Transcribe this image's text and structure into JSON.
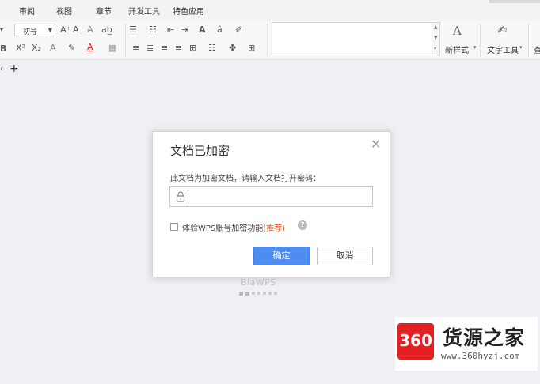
{
  "menubar": {
    "items": [
      "审阅",
      "视图",
      "章节",
      "开发工具",
      "特色应用"
    ]
  },
  "ribbon": {
    "font_size_value": "初号",
    "row1_icons": [
      "A⁺",
      "A⁻",
      "A̶",
      "ab̲",
      "☰",
      "☷",
      "⇤",
      "⇥",
      "A",
      "â",
      "✐"
    ],
    "row2_icons": [
      "B",
      "X²",
      "X₂",
      "A",
      "✎",
      "A",
      "▦",
      "≡",
      "≣",
      "≡",
      "≡",
      "⊞",
      "☷",
      "✤",
      "⊞"
    ],
    "new_style_label": "新样式",
    "text_tool_label": "文字工具",
    "extra_label": "查"
  },
  "tabbar": {
    "left_icon": "‹",
    "add_icon": "+"
  },
  "background": {
    "logo_text": "BiaWPS",
    "dots": 7
  },
  "dialog": {
    "title": "文档已加密",
    "close": "✕",
    "prompt": "此文档为加密文档，请输入文档打开密码：",
    "password_value": "",
    "checkbox_label": "体验WPS账号加密功能",
    "recommend": "(推荐)",
    "help": "?",
    "ok_label": "确定",
    "cancel_label": "取消",
    "ok_color": "#4e8cf0"
  },
  "watermark": {
    "badge": "360",
    "title": "货源之家",
    "url": "www.360hyzj.com",
    "badge_color": "#e32021"
  }
}
